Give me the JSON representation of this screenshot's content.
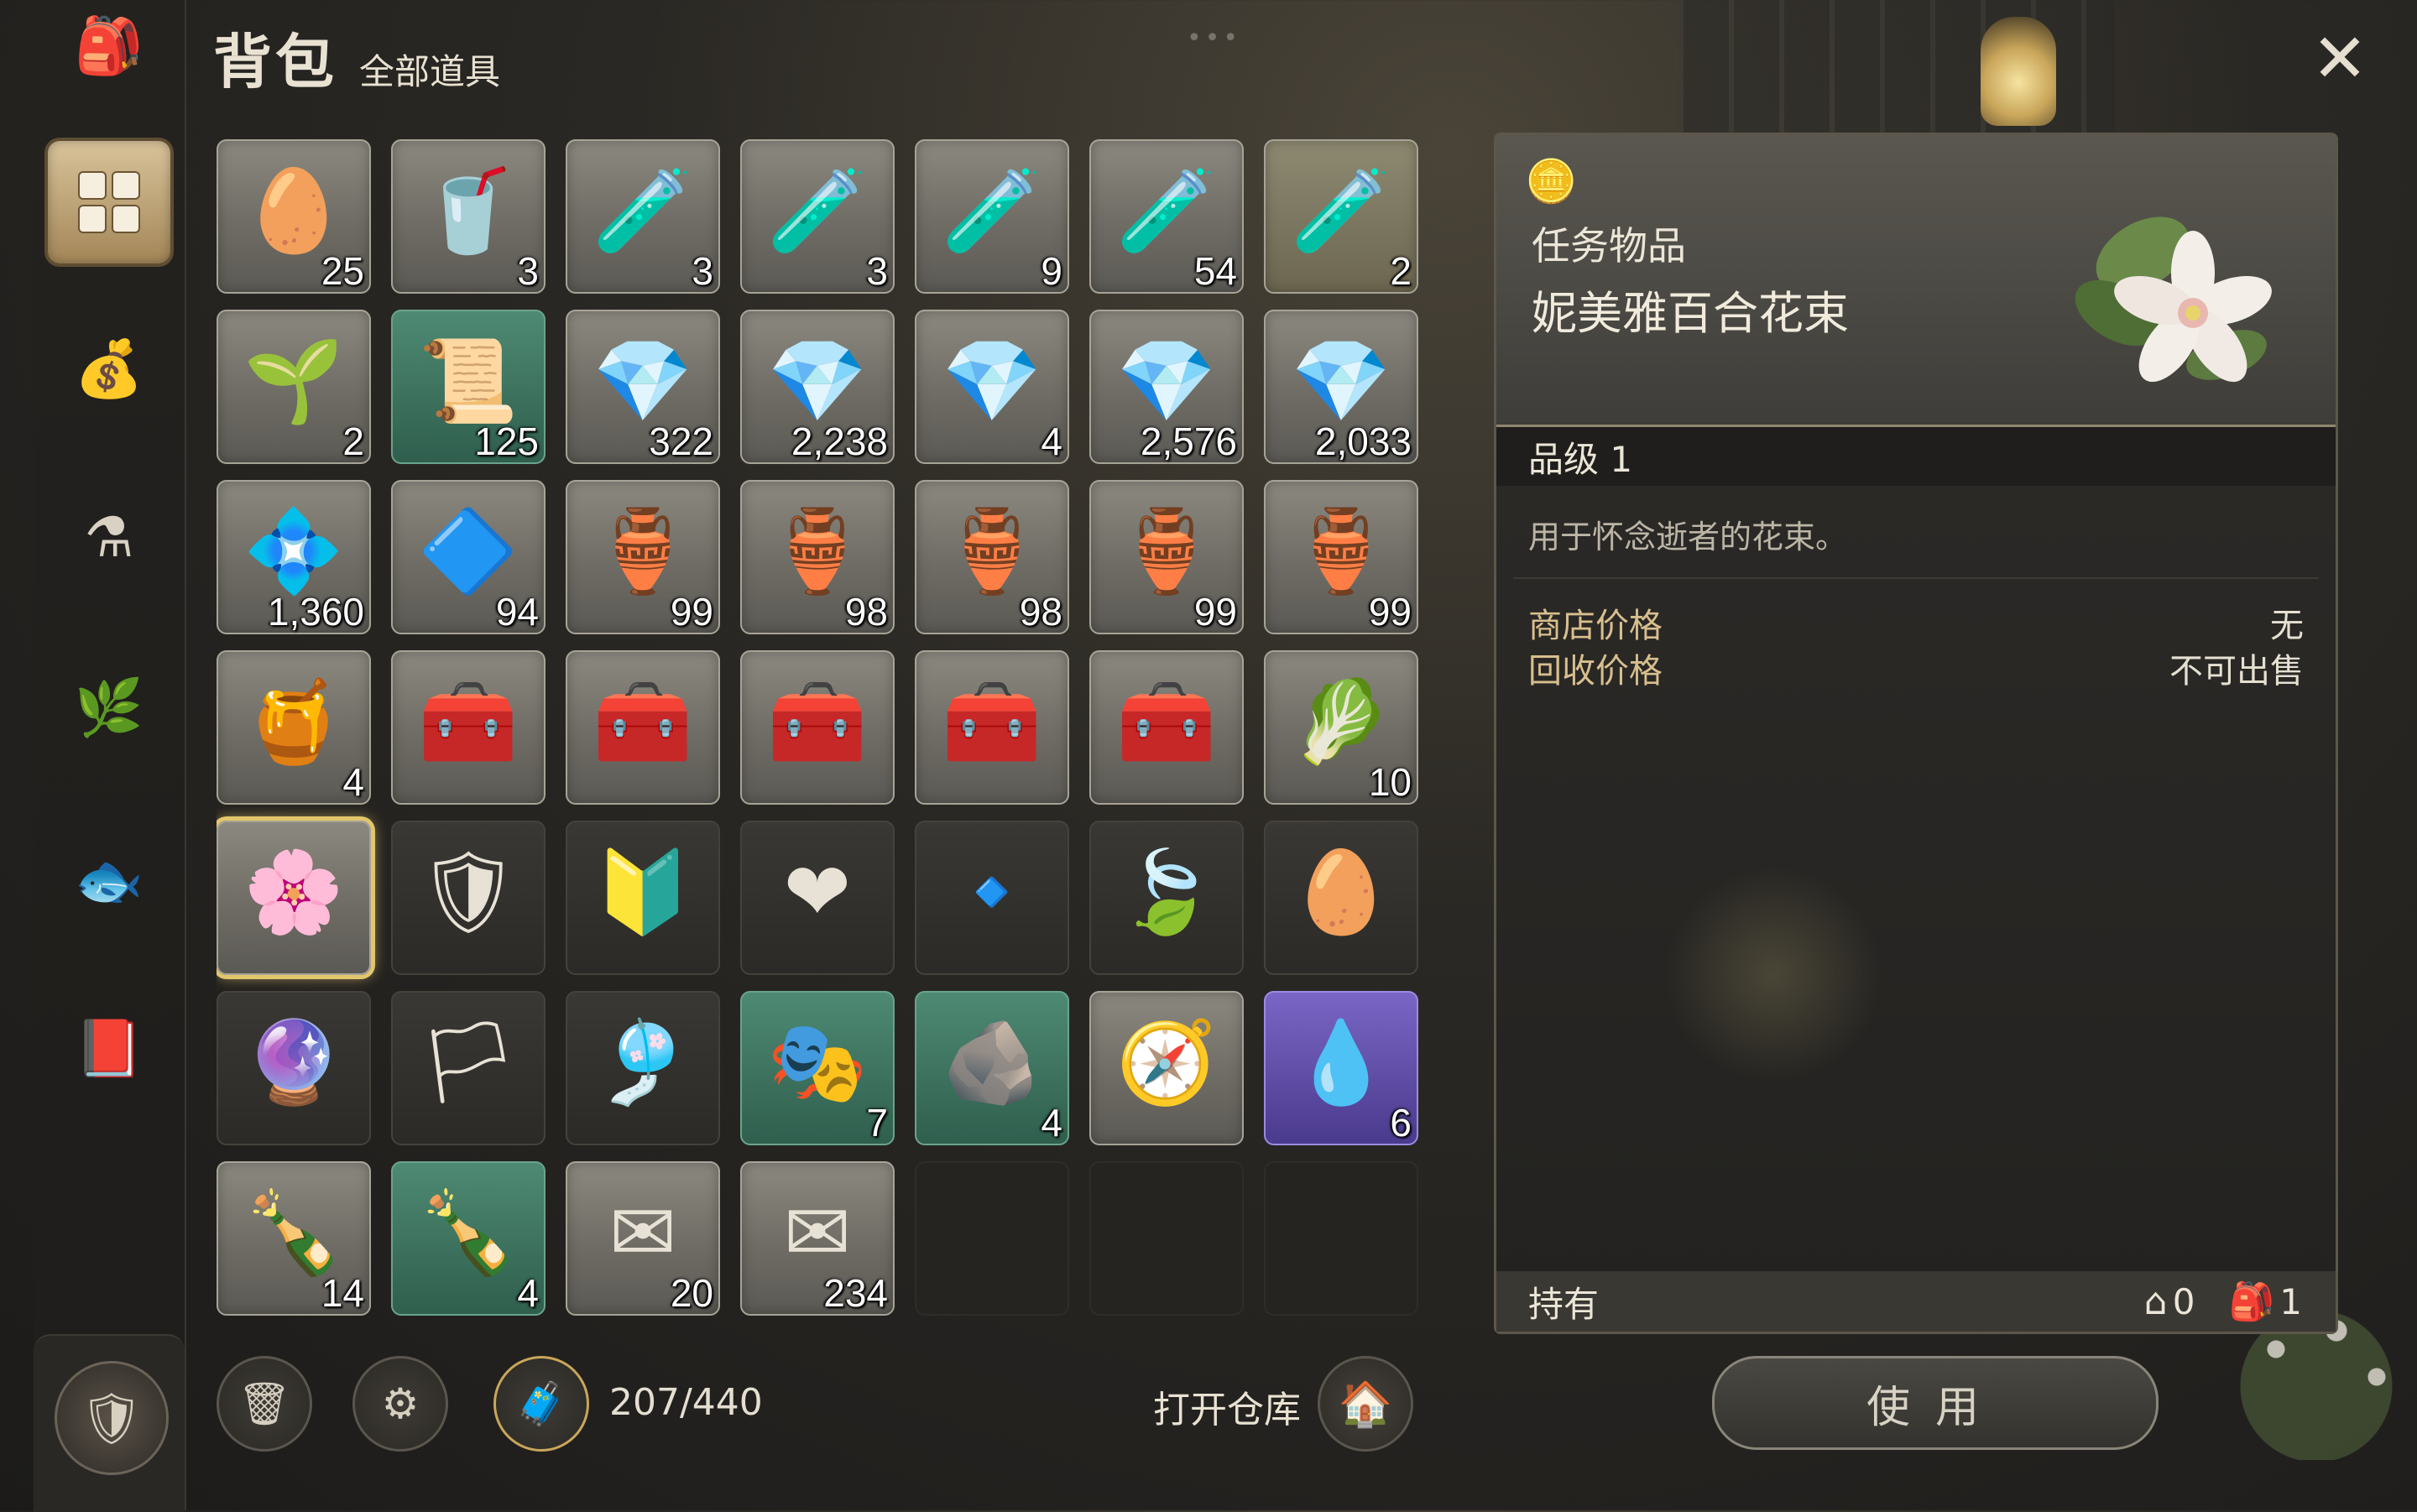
{
  "header": {
    "title": "背包",
    "subtitle": "全部道具",
    "drag_handle": "•••",
    "close_icon": "✕"
  },
  "sidebar": {
    "items": [
      {
        "name": "bag-icon",
        "glyph": "🎒"
      },
      {
        "name": "all-items-grid-icon",
        "glyph": "▦",
        "active": true
      },
      {
        "name": "material-pouch-icon",
        "glyph": "💰"
      },
      {
        "name": "potion-icon",
        "glyph": "⚗"
      },
      {
        "name": "herb-icon",
        "glyph": "🌿"
      },
      {
        "name": "fish-icon",
        "glyph": "🐟"
      },
      {
        "name": "quest-book-icon",
        "glyph": "📕"
      }
    ],
    "bottom_glyph": "🛡"
  },
  "inventory": {
    "slots": [
      {
        "icon": "🥚",
        "count": "25",
        "style": ""
      },
      {
        "icon": "🥤",
        "count": "3",
        "style": ""
      },
      {
        "icon": "🧪",
        "count": "3",
        "style": ""
      },
      {
        "icon": "🧪",
        "count": "3",
        "style": ""
      },
      {
        "icon": "🧪",
        "count": "9",
        "style": ""
      },
      {
        "icon": "🧪",
        "count": "54",
        "style": ""
      },
      {
        "icon": "🧪",
        "count": "2",
        "style": "gold"
      },
      {
        "icon": "🌱",
        "count": "2",
        "style": ""
      },
      {
        "icon": "📜",
        "count": "125",
        "style": "green"
      },
      {
        "icon": "💎",
        "count": "322",
        "style": ""
      },
      {
        "icon": "💎",
        "count": "2,238",
        "style": ""
      },
      {
        "icon": "💎",
        "count": "4",
        "style": ""
      },
      {
        "icon": "💎",
        "count": "2,576",
        "style": ""
      },
      {
        "icon": "💎",
        "count": "2,033",
        "style": ""
      },
      {
        "icon": "💠",
        "count": "1,360",
        "style": ""
      },
      {
        "icon": "🔷",
        "count": "94",
        "style": ""
      },
      {
        "icon": "🏺",
        "count": "99",
        "style": ""
      },
      {
        "icon": "🏺",
        "count": "98",
        "style": ""
      },
      {
        "icon": "🏺",
        "count": "98",
        "style": ""
      },
      {
        "icon": "🏺",
        "count": "99",
        "style": ""
      },
      {
        "icon": "🏺",
        "count": "99",
        "style": ""
      },
      {
        "icon": "🍯",
        "count": "4",
        "style": ""
      },
      {
        "icon": "🧰",
        "count": "",
        "style": ""
      },
      {
        "icon": "🧰",
        "count": "",
        "style": ""
      },
      {
        "icon": "🧰",
        "count": "",
        "style": ""
      },
      {
        "icon": "🧰",
        "count": "",
        "style": ""
      },
      {
        "icon": "🧰",
        "count": "",
        "style": ""
      },
      {
        "icon": "🥬",
        "count": "10",
        "style": ""
      },
      {
        "icon": "🌸",
        "count": "",
        "style": "selected"
      },
      {
        "icon": "🛡",
        "count": "",
        "style": "dark"
      },
      {
        "icon": "🔰",
        "count": "",
        "style": "dark"
      },
      {
        "icon": "❤",
        "count": "",
        "style": "dark"
      },
      {
        "icon": "🔹",
        "count": "",
        "style": "dark"
      },
      {
        "icon": "🍃",
        "count": "",
        "style": "dark"
      },
      {
        "icon": "🥚",
        "count": "",
        "style": "dark"
      },
      {
        "icon": "🔮",
        "count": "",
        "style": "dark"
      },
      {
        "icon": "🏳",
        "count": "",
        "style": "dark"
      },
      {
        "icon": "🎐",
        "count": "",
        "style": "dark"
      },
      {
        "icon": "🎭",
        "count": "7",
        "style": "green"
      },
      {
        "icon": "🪨",
        "count": "4",
        "style": "green"
      },
      {
        "icon": "🧭",
        "count": "",
        "style": ""
      },
      {
        "icon": "💧",
        "count": "6",
        "style": "purple"
      },
      {
        "icon": "🍾",
        "count": "14",
        "style": ""
      },
      {
        "icon": "🍾",
        "count": "4",
        "style": "green"
      },
      {
        "icon": "✉",
        "count": "20",
        "style": ""
      },
      {
        "icon": "✉",
        "count": "234",
        "style": ""
      },
      {
        "icon": "",
        "count": "",
        "style": "empty"
      },
      {
        "icon": "",
        "count": "",
        "style": "empty"
      },
      {
        "icon": "",
        "count": "",
        "style": "empty"
      }
    ]
  },
  "toolbar": {
    "trash_glyph": "🗑",
    "bag_settings_glyph": "⚙",
    "expand_glyph": "🧳",
    "capacity": "207/440",
    "open_warehouse_label": "打开仓库",
    "warehouse_glyph": "🏠"
  },
  "detail": {
    "type_icon": "🪙",
    "item_type": "任务物品",
    "item_name": "妮美雅百合花束",
    "grade": "品级 1",
    "description": "用于怀念逝者的花束。",
    "shop_price_label": "商店价格",
    "shop_price_value": "无",
    "sell_price_label": "回收价格",
    "sell_price_value": "不可出售",
    "own_label": "持有",
    "own_warehouse_icon": "⌂",
    "own_warehouse_count": "0",
    "own_bag_icon": "🎒",
    "own_bag_count": "1",
    "use_label": "使用"
  },
  "colors": {
    "accent_gold": "#e2c66c",
    "label_gold": "#d8bf8e",
    "panel_bg": "#2e2c29"
  }
}
